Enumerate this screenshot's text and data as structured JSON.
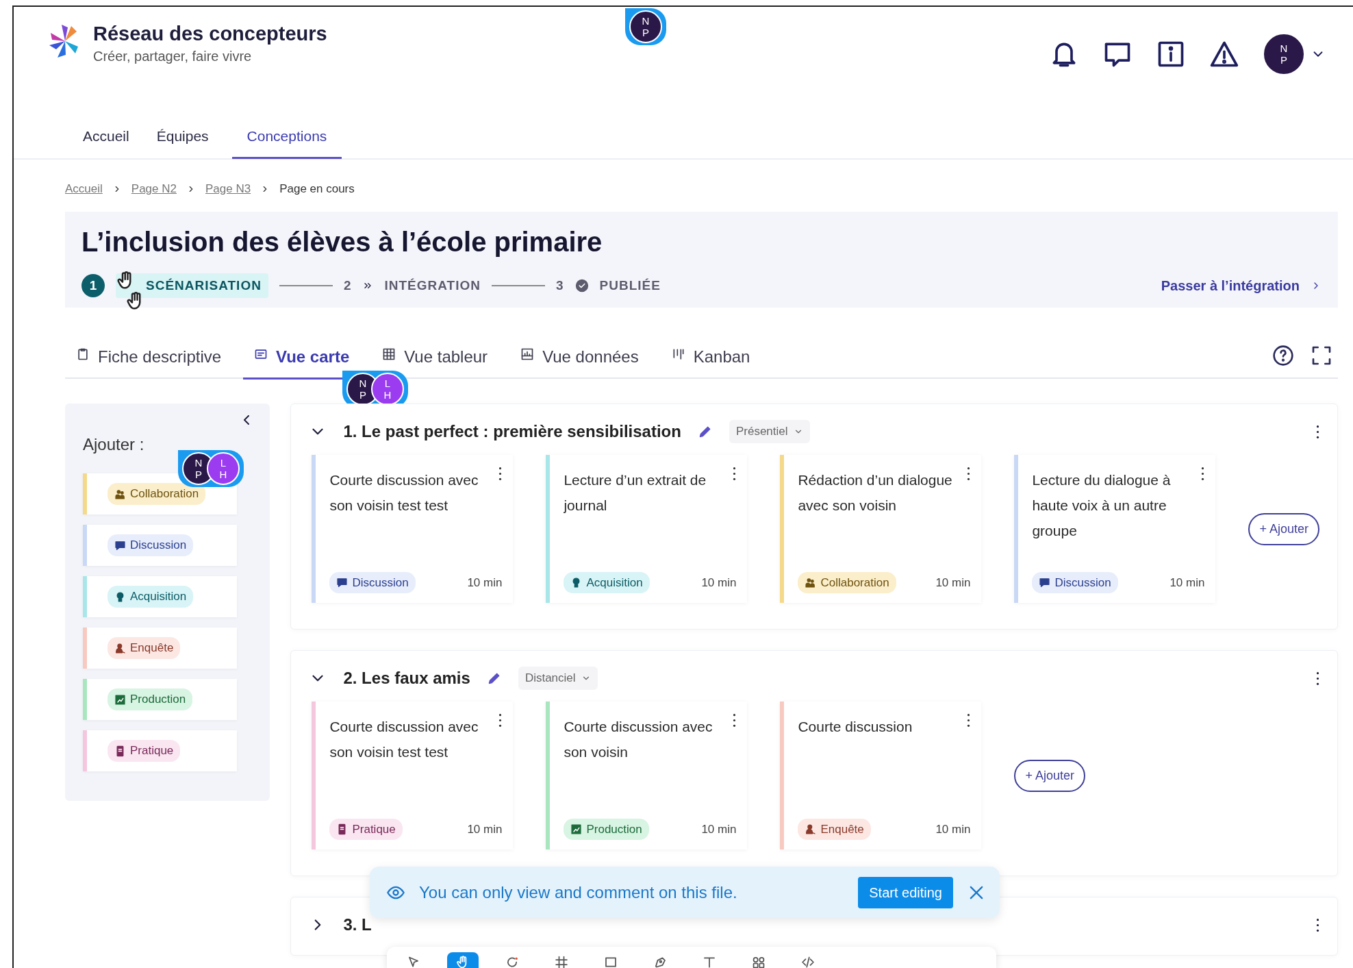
{
  "header": {
    "title": "Réseau des concepteurs",
    "subtitle": "Créer, partager, faire vivre",
    "cursor": {
      "avatars": [
        {
          "initials": "N P",
          "color": "#2a1848"
        }
      ]
    },
    "user": {
      "initials": "N P"
    }
  },
  "nav": [
    {
      "label": "Accueil",
      "selected": false
    },
    {
      "label": "Équipes",
      "selected": false
    },
    {
      "label": "Conceptions",
      "selected": true
    }
  ],
  "breadcrumb": [
    {
      "label": "Accueil",
      "kind": "link"
    },
    {
      "label": "Page N2",
      "kind": "link"
    },
    {
      "label": "Page N3",
      "kind": "link"
    },
    {
      "label": "Page en cours",
      "kind": "current"
    }
  ],
  "page": {
    "title": "L’inclusion des élèves à l’école primaire",
    "steps": [
      {
        "number": "1",
        "label": "SCÉNARISATION",
        "current": true
      },
      {
        "number": "2",
        "label": "INTÉGRATION",
        "current": false,
        "kind": "chevrons"
      },
      {
        "number": "3",
        "label": "PUBLIÉE",
        "current": false,
        "kind": "check"
      }
    ],
    "next_link": "Passer à l’intégration"
  },
  "tabs": {
    "items": [
      {
        "label": "Fiche descriptive",
        "kind": "clipboard",
        "selected": false
      },
      {
        "label": "Vue carte",
        "kind": "card",
        "selected": true
      },
      {
        "label": "Vue tableur",
        "kind": "grid",
        "selected": false
      },
      {
        "label": "Vue données",
        "kind": "chart",
        "selected": false
      },
      {
        "label": "Kanban",
        "kind": "kanban",
        "selected": false
      }
    ],
    "cursor": {
      "avatars": [
        {
          "initials": "N P",
          "color": "#2a1848"
        },
        {
          "initials": "L H",
          "color": "#9b3cf0"
        }
      ]
    }
  },
  "sidebar": {
    "title": "Ajouter :",
    "cursor": {
      "avatars": [
        {
          "initials": "N P",
          "color": "#2a1848"
        },
        {
          "initials": "L H",
          "color": "#9b3cf0"
        }
      ]
    },
    "items": [
      {
        "label": "Collaboration",
        "kind": "collaboration",
        "color": "#f5d98a"
      },
      {
        "label": "Discussion",
        "kind": "discussion",
        "color": "#c9d8f5"
      },
      {
        "label": "Acquisition",
        "kind": "acquisition",
        "color": "#a8e6ea"
      },
      {
        "label": "Enquête",
        "kind": "enquete",
        "color": "#f8c9c0"
      },
      {
        "label": "Production",
        "kind": "production",
        "color": "#a9e6bf"
      },
      {
        "label": "Pratique",
        "kind": "pratique",
        "color": "#f4c7df"
      }
    ]
  },
  "sections": [
    {
      "title": "1. Le past perfect : première sensibilisation",
      "expanded": true,
      "mode": "Présentiel",
      "add_label": "+ Ajouter",
      "cards": [
        {
          "title": "Courte discussion avec son voisin test test",
          "tag": "Discussion",
          "kind": "discussion",
          "color": "#c9d8f5",
          "duration": "10 min"
        },
        {
          "title": "Lecture d’un extrait de journal",
          "tag": "Acquisition",
          "kind": "acquisition",
          "color": "#a8e6ea",
          "duration": "10 min"
        },
        {
          "title": "Rédaction d’un dialogue avec son voisin",
          "tag": "Collaboration",
          "kind": "collaboration",
          "color": "#f5d98a",
          "duration": "10 min"
        },
        {
          "title": "Lecture du dialogue à haute voix à un autre groupe",
          "tag": "Discussion",
          "kind": "discussion",
          "color": "#c9d8f5",
          "duration": "10 min"
        }
      ]
    },
    {
      "title": "2. Les faux amis",
      "expanded": true,
      "mode": "Distanciel",
      "add_label": "+ Ajouter",
      "cards": [
        {
          "title": "Courte discussion avec son voisin test test",
          "tag": "Pratique",
          "kind": "pratique",
          "color": "#f4c7df",
          "duration": "10 min"
        },
        {
          "title": "Courte discussion avec son voisin",
          "tag": "Production",
          "kind": "production",
          "color": "#a9e6bf",
          "duration": "10 min"
        },
        {
          "title": "Courte discussion",
          "tag": "Enquête",
          "kind": "enquete",
          "color": "#f8c9c0",
          "duration": "10 min"
        }
      ]
    },
    {
      "title": "3. L",
      "expanded": false
    }
  ],
  "toast": {
    "message": "You can only view and comment on this file.",
    "button": "Start editing"
  },
  "toolbar": [
    {
      "kind": "move",
      "selected": false
    },
    {
      "kind": "hand",
      "selected": true
    },
    {
      "kind": "comment",
      "selected": false
    },
    {
      "kind": "frame",
      "selected": false
    },
    {
      "kind": "rect",
      "selected": false
    },
    {
      "kind": "pen",
      "selected": false
    },
    {
      "kind": "text",
      "selected": false
    },
    {
      "kind": "resources",
      "selected": false
    },
    {
      "kind": "code",
      "selected": false
    }
  ]
}
